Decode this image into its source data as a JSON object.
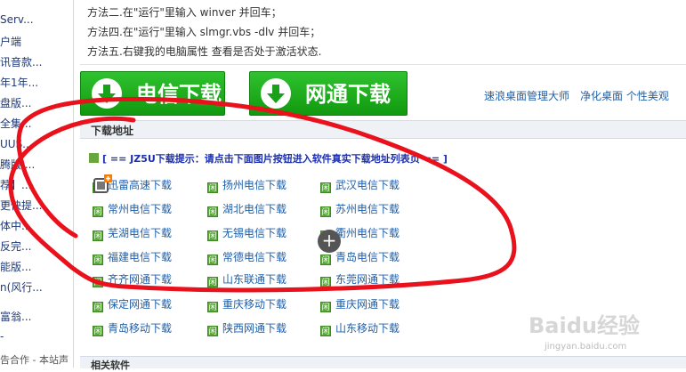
{
  "sidebar": {
    "items": [
      "Serv...",
      "户端",
      "讯音款...",
      "年1年...",
      "盘版...",
      "全集...",
      "UUS...",
      "腾版 ...",
      "荐】...",
      "更快提...",
      "体中...",
      "反完...",
      "能版...",
      "n(风行...",
      "富翁...",
      "-"
    ],
    "footer": "告合作 - 本站声"
  },
  "methods": [
    "方法二.在\"运行\"里输入 winver 并回车；",
    "方法四.在\"运行\"里输入 slmgr.vbs -dlv 并回车；",
    "方法五.右键我的电脑属性 查看是否处于激活状态."
  ],
  "big_buttons": {
    "telecom": "电信下载",
    "netcom": "网通下载"
  },
  "top_links": [
    "速浪桌面管理大师",
    "净化桌面 个性美观"
  ],
  "download_section": {
    "title": "下载地址",
    "tip": "[ == JZ5U下载提示：请点击下面图片按钮进入软件真实下载地址列表页 == ]",
    "badge": "闲",
    "links": [
      [
        "迅雷高速下载",
        "扬州电信下载",
        "武汉电信下载"
      ],
      [
        "常州电信下载",
        "湖北电信下载",
        "苏州电信下载"
      ],
      [
        "芜湖电信下载",
        "无锡电信下载",
        "衢州电信下载"
      ],
      [
        "福建电信下载",
        "常德电信下载",
        "青岛电信下载"
      ],
      [
        "齐齐网通下载",
        "山东联通下载",
        "东莞网通下载"
      ],
      [
        "保定网通下载",
        "重庆移动下载",
        "重庆网通下载"
      ],
      [
        "青岛移动下载",
        "陕西网通下载",
        "山东移动下载"
      ]
    ]
  },
  "related_title": "相关软件",
  "watermark": {
    "logo": "Baidu经验",
    "url": "jingyan.baidu.com"
  },
  "colors": {
    "annotation": "#e8111c",
    "button_green": "#1aa51a",
    "link_blue": "#1f5fa8",
    "tip_blue": "#1c2fb0"
  }
}
